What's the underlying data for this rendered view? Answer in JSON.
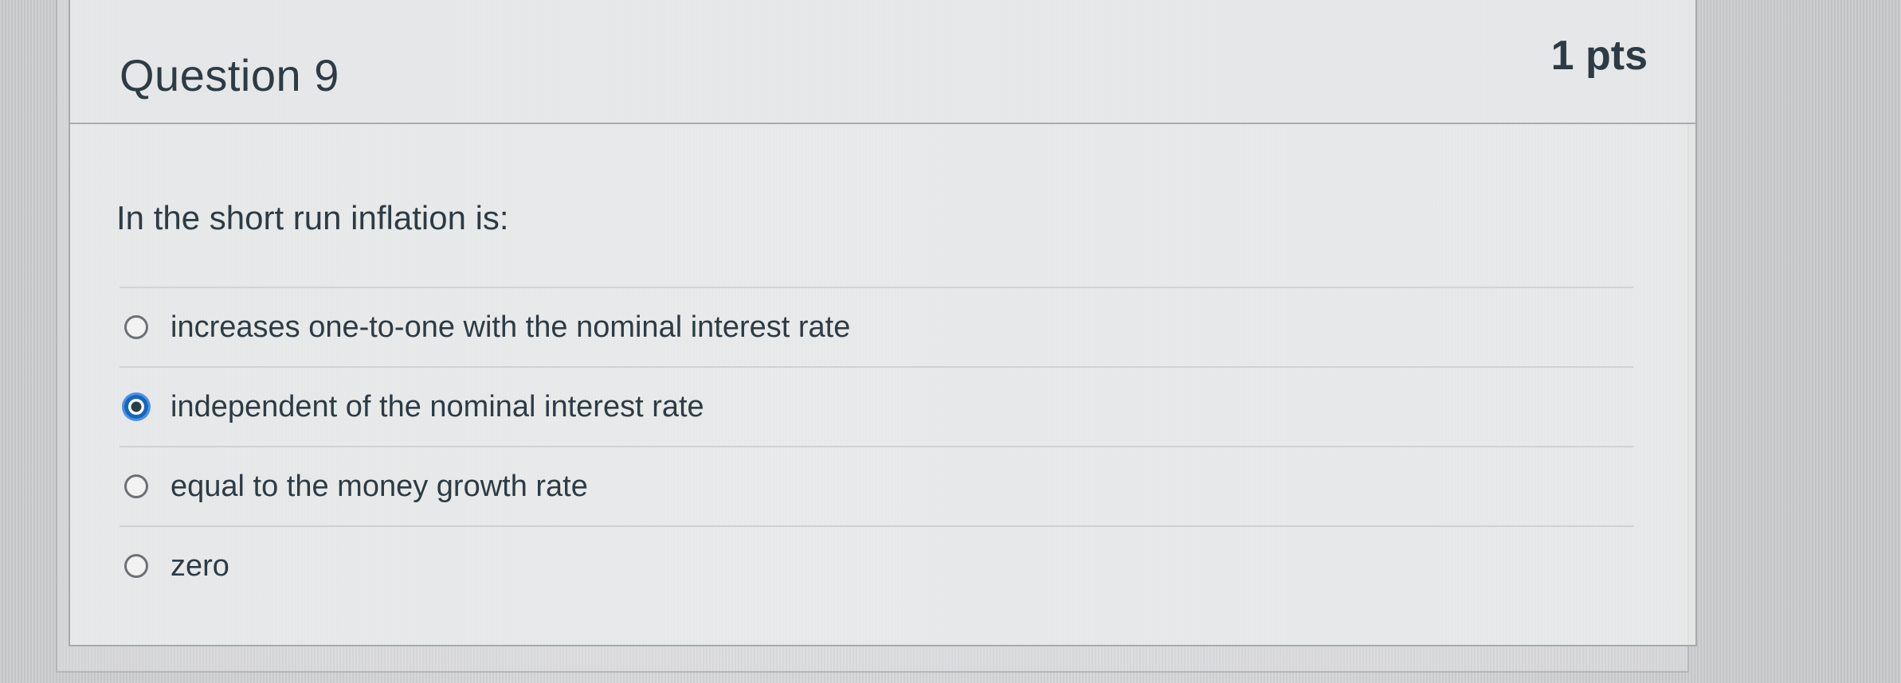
{
  "question": {
    "title": "Question 9",
    "points": "1 pts",
    "text": "In the short run inflation is:",
    "answers": [
      {
        "label": "increases one-to-one with the nominal interest rate",
        "selected": false
      },
      {
        "label": "independent of the nominal interest rate",
        "selected": true
      },
      {
        "label": "equal to the money growth rate",
        "selected": false
      },
      {
        "label": "zero",
        "selected": false
      }
    ]
  },
  "colors": {
    "text": "#2d3b45",
    "selected_radio": "#1565c0",
    "border": "#a7a9ab"
  }
}
